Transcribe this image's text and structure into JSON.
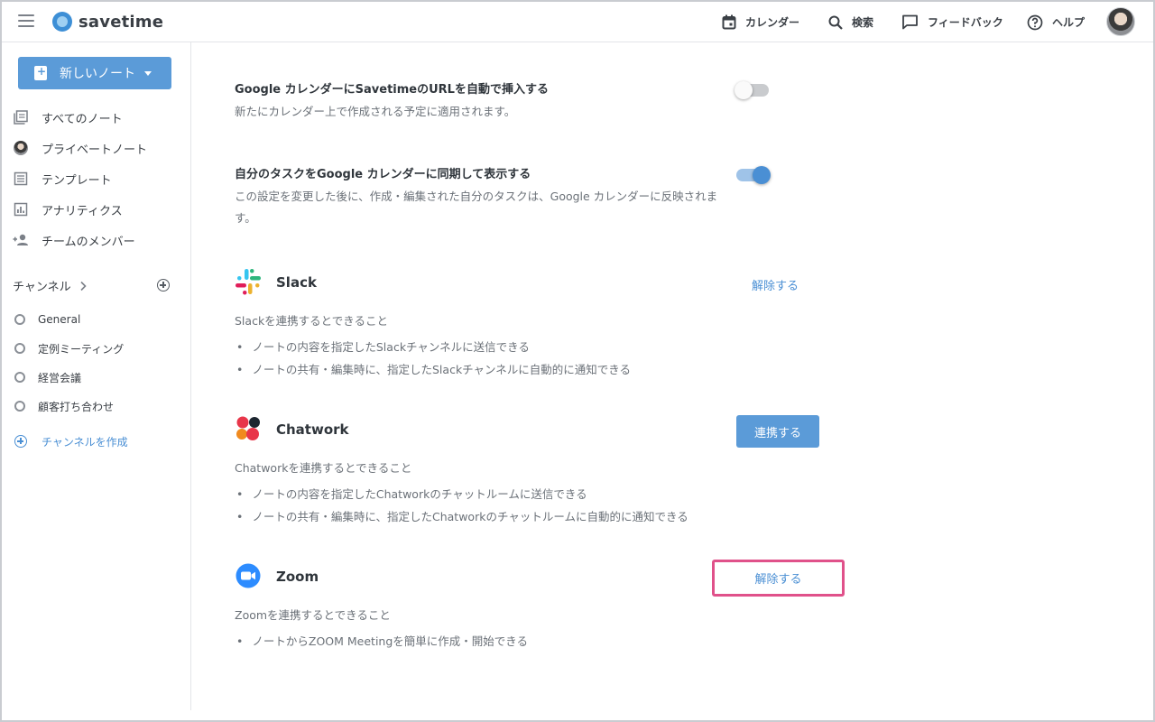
{
  "header": {
    "logo_text": "savetime",
    "nav": {
      "calendar": "カレンダー",
      "search": "検索",
      "feedback": "フィードバック",
      "help": "ヘルプ"
    }
  },
  "sidebar": {
    "new_note_label": "新しいノート",
    "items": [
      {
        "label": "すべてのノート",
        "icon": "notes-icon"
      },
      {
        "label": "プライベートノート",
        "icon": "avatar"
      },
      {
        "label": "テンプレート",
        "icon": "template-icon"
      },
      {
        "label": "アナリティクス",
        "icon": "analytics-icon"
      },
      {
        "label": "チームのメンバー",
        "icon": "add-member-icon"
      }
    ],
    "channel_heading": "チャンネル",
    "channels": [
      "General",
      "定例ミーティング",
      "経営会議",
      "顧客打ち合わせ"
    ],
    "create_channel_label": "チャンネルを作成"
  },
  "settings": [
    {
      "title": "Google カレンダーにSavetimeのURLを自動で挿入する",
      "description": "新たにカレンダー上で作成される予定に適用されます。",
      "enabled": false
    },
    {
      "title": "自分のタスクをGoogle カレンダーに同期して表示する",
      "description": "この設定を変更した後に、作成・編集された自分のタスクは、Google カレンダーに反映されます。",
      "enabled": true
    }
  ],
  "integrations": {
    "slack": {
      "name": "Slack",
      "action": "解除する",
      "subtitle": "Slackを連携するとできること",
      "features": [
        "ノートの内容を指定したSlackチャンネルに送信できる",
        "ノートの共有・編集時に、指定したSlackチャンネルに自動的に通知できる"
      ]
    },
    "chatwork": {
      "name": "Chatwork",
      "action": "連携する",
      "subtitle": "Chatworkを連携するとできること",
      "features": [
        "ノートの内容を指定したChatworkのチャットルームに送信できる",
        "ノートの共有・編集時に、指定したChatworkのチャットルームに自動的に通知できる"
      ]
    },
    "zoom": {
      "name": "Zoom",
      "action": "解除する",
      "subtitle": "Zoomを連携するとできること",
      "features": [
        "ノートからZOOM Meetingを簡単に作成・開始できる"
      ]
    }
  },
  "colors": {
    "accent": "#5b9bd8",
    "link": "#4a8fd4",
    "highlight": "#e0518a"
  }
}
